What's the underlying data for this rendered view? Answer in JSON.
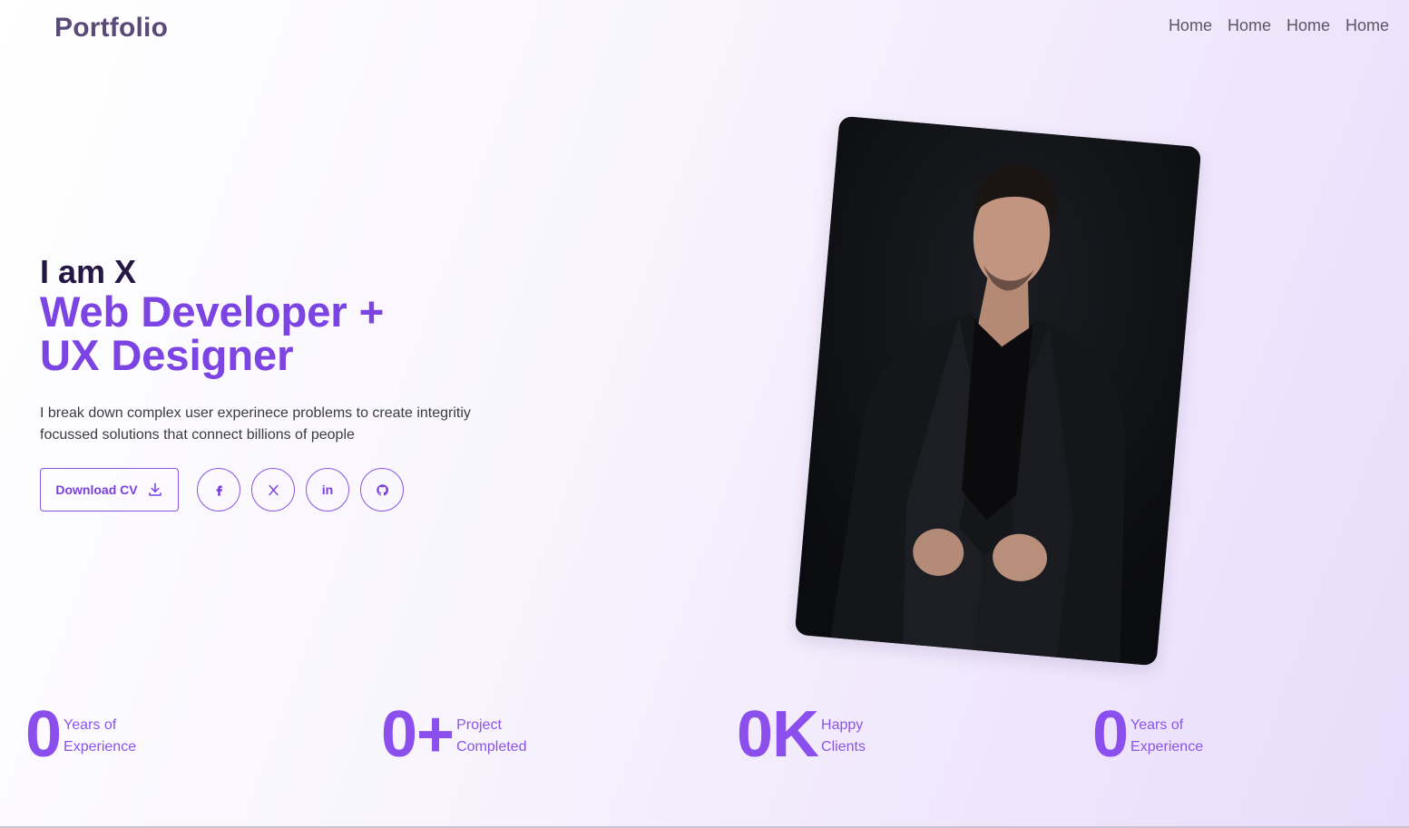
{
  "header": {
    "logo": "Portfolio",
    "nav": [
      "Home",
      "Home",
      "Home",
      "Home"
    ]
  },
  "hero": {
    "intro": "I am X",
    "role_line1": "Web Developer +",
    "role_line2": "UX Designer",
    "description": "I break down complex user experinece problems to create integritiy focussed solutions that connect billions of people",
    "download_label": "Download CV",
    "socials": [
      {
        "name": "facebook-icon"
      },
      {
        "name": "x-icon"
      },
      {
        "name": "linkedin-icon",
        "text": "in"
      },
      {
        "name": "github-icon"
      }
    ]
  },
  "stats": [
    {
      "value": "0",
      "line1": "Years of",
      "line2": "Experience"
    },
    {
      "value": "0+",
      "line1": "Project",
      "line2": "Completed"
    },
    {
      "value": "0K",
      "line1": "Happy",
      "line2": "Clients"
    },
    {
      "value": "0",
      "line1": "Years of",
      "line2": "Experience"
    }
  ],
  "colors": {
    "accent": "#7a3fe0",
    "heading": "#241744",
    "logo": "#5a4a78"
  }
}
